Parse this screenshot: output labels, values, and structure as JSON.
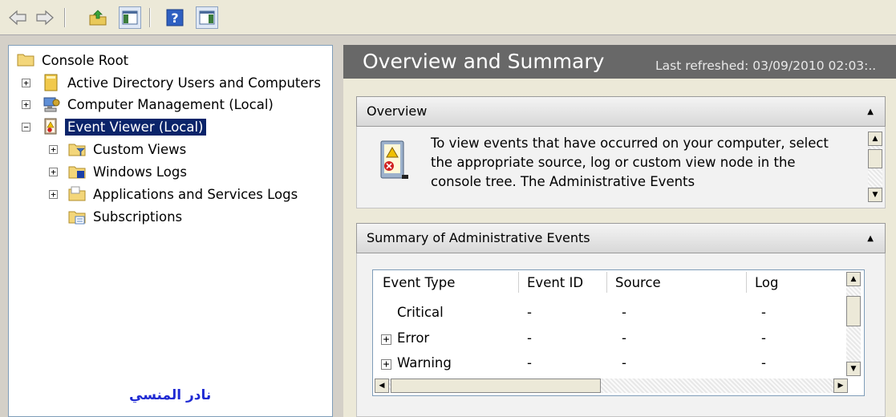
{
  "toolbar": {
    "buttons": [
      "back-icon",
      "forward-icon",
      "up-folder-icon",
      "show-hide-console-tree-icon",
      "help-icon",
      "show-hide-action-pane-icon"
    ]
  },
  "tree": {
    "root": "Console Root",
    "items": [
      {
        "label": "Active Directory Users and Computers",
        "expander": "+"
      },
      {
        "label": "Computer Management (Local)",
        "expander": "+"
      },
      {
        "label": "Event Viewer (Local)",
        "expander": "−",
        "selected": true
      },
      {
        "label": "Custom Views",
        "expander": "+"
      },
      {
        "label": "Windows Logs",
        "expander": "+"
      },
      {
        "label": "Applications and Services Logs",
        "expander": "+"
      },
      {
        "label": "Subscriptions"
      }
    ],
    "signature": "نادر المنسي"
  },
  "main": {
    "title": "Overview and Summary",
    "last_refreshed": "Last refreshed: 03/09/2010 02:03:..",
    "overview": {
      "title": "Overview",
      "text": "To view events that have occurred on your computer, select the appropriate source, log or custom view node in the console tree. The Administrative Events"
    },
    "summary": {
      "title": "Summary of Administrative Events",
      "columns": [
        "Event Type",
        "Event ID",
        "Source",
        "Log"
      ],
      "rows": [
        {
          "type": "Critical",
          "expander": "",
          "id": "-",
          "source": "-",
          "log": "-"
        },
        {
          "type": "Error",
          "expander": "+",
          "id": "-",
          "source": "-",
          "log": "-"
        },
        {
          "type": "Warning",
          "expander": "+",
          "id": "-",
          "source": "-",
          "log": "-"
        }
      ]
    }
  },
  "colors": {
    "selection": "#0a246a",
    "header_bg": "#686868",
    "signature": "#1f2ad3"
  }
}
